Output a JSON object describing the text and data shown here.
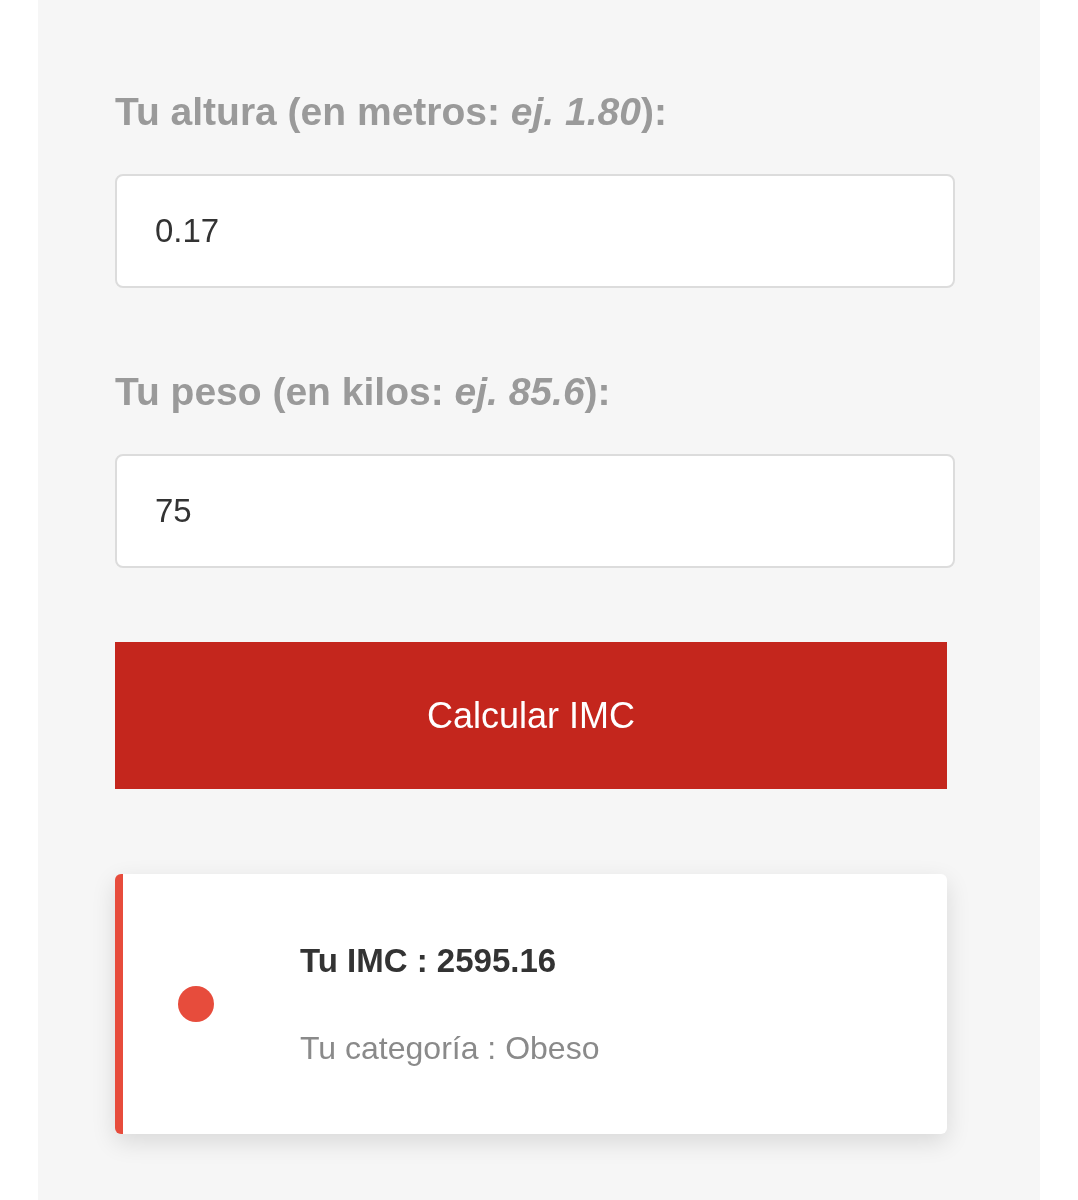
{
  "fields": [
    {
      "label": "Tu altura (en metros: *ej. 1.80*):",
      "value": "0.17"
    },
    {
      "label": "Tu peso (en kilos: *ej. 85.6*):",
      "value": "75"
    }
  ],
  "button": {
    "label": "Calcular IMC"
  },
  "result": {
    "imc": "Tu IMC : 2595.16",
    "category": "Tu categoría : Obeso",
    "color": "#e74c3c"
  }
}
